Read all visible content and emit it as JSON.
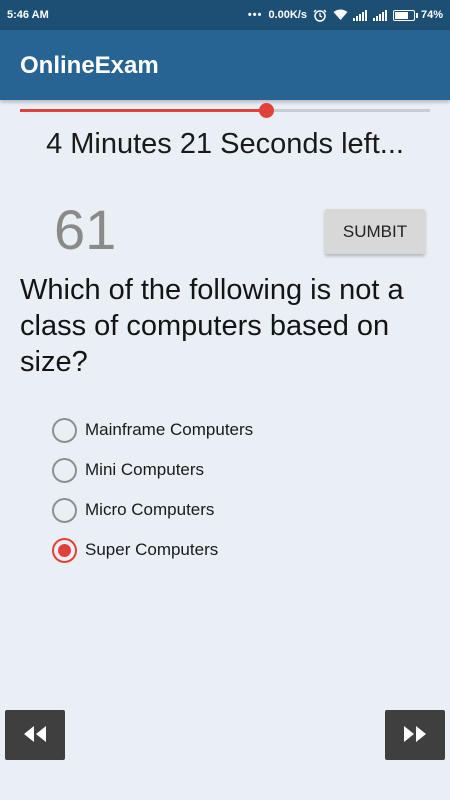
{
  "status_bar": {
    "time": "5:46 AM",
    "speed": "0.00K/s",
    "battery_percent": "74%",
    "battery_level": 0.74,
    "icons": [
      "more-dots-icon",
      "alarm-icon",
      "wifi-icon",
      "signal-icon",
      "signal-icon",
      "battery-icon"
    ]
  },
  "app_bar": {
    "title": "OnlineExam"
  },
  "progress": {
    "value": 0.6
  },
  "timer": {
    "text": "4 Minutes 21 Seconds left..."
  },
  "question": {
    "number": "61",
    "text": "Which of the following is not a class of computers based on size?",
    "options": [
      {
        "label": "Mainframe Computers",
        "selected": false
      },
      {
        "label": "Mini Computers",
        "selected": false
      },
      {
        "label": "Micro Computers",
        "selected": false
      },
      {
        "label": "Super Computers",
        "selected": true
      }
    ]
  },
  "actions": {
    "submit_label": "SUMBIT",
    "prev_icon": "rewind-icon",
    "next_icon": "fast-forward-icon"
  },
  "colors": {
    "status_bar": "#1d4f74",
    "app_bar": "#276493",
    "accent": "#e2413a",
    "background": "#e9eff5",
    "nav_button": "#3f3f3f"
  }
}
